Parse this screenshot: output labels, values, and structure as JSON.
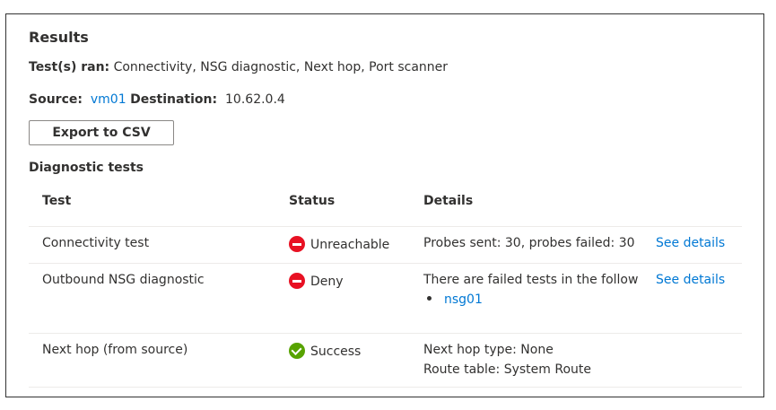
{
  "results": {
    "title": "Results",
    "tests_ran_label": "Test(s) ran:",
    "tests_ran_value": "Connectivity, NSG diagnostic, Next hop, Port scanner",
    "source_label": "Source:",
    "source_value": "vm01",
    "destination_label": "Destination:",
    "destination_value": "10.62.0.4",
    "export_label": "Export to CSV"
  },
  "diagnostic": {
    "title": "Diagnostic tests",
    "columns": [
      "Test",
      "Status",
      "Details"
    ],
    "rows": [
      {
        "test": "Connectivity test",
        "status": "Unreachable",
        "status_icon": "deny-icon",
        "details": "Probes sent: 30, probes failed: 30",
        "link": "See details"
      },
      {
        "test": "Outbound NSG diagnostic",
        "status": "Deny",
        "status_icon": "deny-icon",
        "details": "There are failed tests in the follow",
        "list_item": "nsg01",
        "link": "See details"
      },
      {
        "test": "Next hop (from source)",
        "status": "Success",
        "status_icon": "success-check-icon",
        "details": "Next hop type: None",
        "details2": "Route table: System Route"
      }
    ]
  },
  "colors": {
    "link": "#0078d4",
    "deny": "#e81123",
    "success": "#57a300"
  }
}
